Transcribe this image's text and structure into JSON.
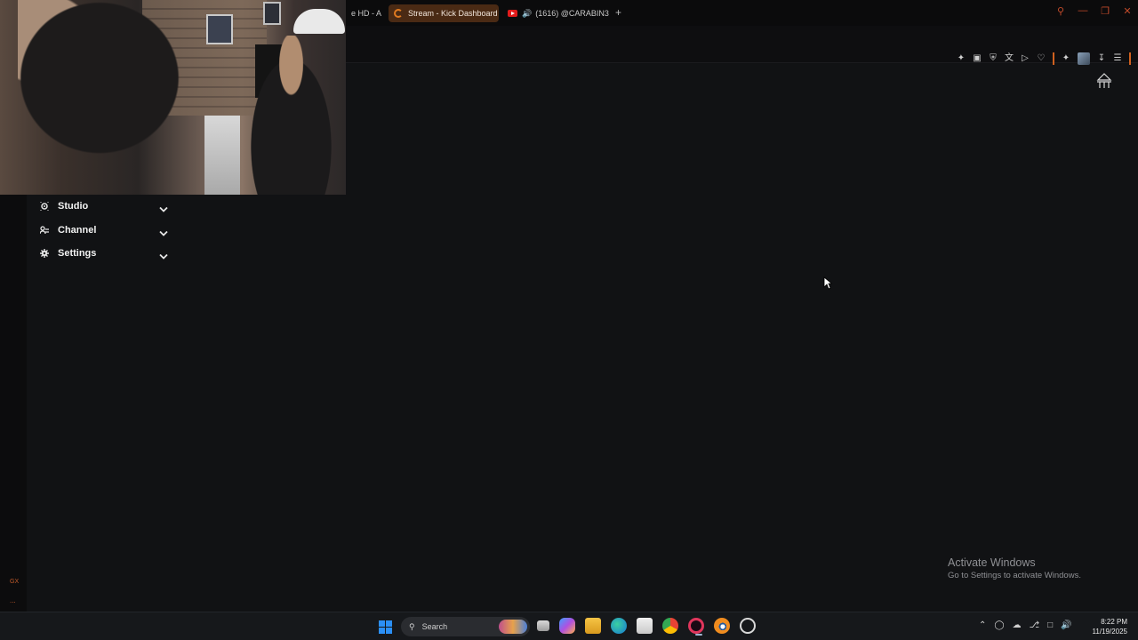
{
  "browser": {
    "tabs": [
      {
        "label": "e HD - A"
      },
      {
        "label": "Stream - Kick Dashboard",
        "active": true
      },
      {
        "label": "(1616)  @CARABIN3"
      }
    ],
    "new_tab_symbol": "+",
    "window_controls": [
      "search-icon",
      "minimize-icon",
      "restore-icon",
      "close-icon"
    ],
    "toolbar_icons": [
      "pin-icon",
      "screenshot-icon",
      "shield-icon",
      "translate-icon",
      "play-icon",
      "heart-icon",
      "extensions-icon",
      "profile-avatar",
      "download-icon",
      "menu-icon"
    ]
  },
  "sidebar": {
    "items": [
      {
        "label": "Studio",
        "icon": "studio-icon"
      },
      {
        "label": "Channel",
        "icon": "channel-icon"
      },
      {
        "label": "Settings",
        "icon": "gear-icon"
      }
    ]
  },
  "rail": {
    "gx_label": "GX",
    "more_label": "..."
  },
  "watermark": {
    "title": "Activate Windows",
    "subtitle": "Go to Settings to activate Windows."
  },
  "taskbar": {
    "search_placeholder": "Search",
    "apps": [
      "task-view-icon",
      "copilot-icon",
      "file-explorer-icon",
      "edge-icon",
      "store-icon",
      "chrome-icon",
      "opera-gx-icon",
      "blender-icon",
      "app-icon"
    ],
    "time": "8:22 PM",
    "date": "11/19/2025"
  },
  "colors": {
    "accent": "#d0611f",
    "background": "#111214",
    "active_tab": "#4a2a14"
  }
}
